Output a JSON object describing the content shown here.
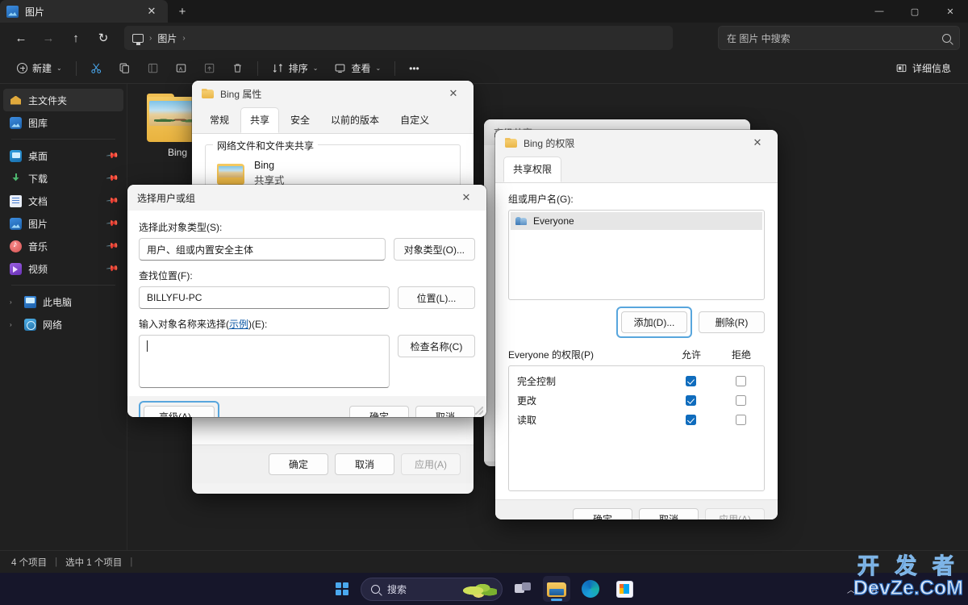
{
  "explorer": {
    "tab": {
      "title": "图片",
      "close_label": "✕",
      "new_tab_label": "+",
      "icon": "pictures-icon"
    },
    "window_controls": {
      "minimize": "—",
      "maximize": "▢",
      "close": "✕"
    },
    "nav": {
      "back": "←",
      "forward": "→",
      "up": "↑",
      "refresh": "↻",
      "breadcrumb": [
        "图片"
      ],
      "breadcrumb_sep": "›"
    },
    "search": {
      "placeholder": "在 图片 中搜索",
      "icon": "search-icon"
    },
    "toolbar": {
      "new_label": "新建",
      "cut_label": "剪切",
      "copy_label": "复制",
      "paste_label": "粘贴",
      "rename_label": "重命名",
      "share_label": "共享",
      "delete_label": "删除",
      "sort_label": "排序",
      "view_label": "查看",
      "more_label": "•••",
      "details_label": "详细信息",
      "chevron": "⌄"
    },
    "sidebar": {
      "items": [
        {
          "label": "主文件夹",
          "icon": "home-icon",
          "selected": true
        },
        {
          "label": "图库",
          "icon": "gallery-icon",
          "selected": false
        }
      ],
      "pinned": [
        {
          "label": "桌面",
          "icon": "desktop-icon",
          "pin": "📌"
        },
        {
          "label": "下载",
          "icon": "download-icon",
          "pin": "📌"
        },
        {
          "label": "文档",
          "icon": "documents-icon",
          "pin": "📌"
        },
        {
          "label": "图片",
          "icon": "pictures-icon",
          "pin": "📌"
        },
        {
          "label": "音乐",
          "icon": "music-icon",
          "pin": "📌"
        },
        {
          "label": "视频",
          "icon": "video-icon",
          "pin": "📌"
        }
      ],
      "trees": [
        {
          "label": "此电脑",
          "icon": "this-pc-icon",
          "arrow": "›"
        },
        {
          "label": "网络",
          "icon": "network-icon",
          "arrow": "›"
        }
      ]
    },
    "files": [
      {
        "name": "Bing",
        "icon": "folder-icon"
      }
    ],
    "status": {
      "count": "4 个项目",
      "sep1": "|",
      "selected": "选中 1 个项目",
      "sep2": "|"
    }
  },
  "dialog_properties": {
    "title": "Bing 属性",
    "close": "✕",
    "tabs": [
      {
        "label": "常规",
        "active": false
      },
      {
        "label": "共享",
        "active": true
      },
      {
        "label": "安全",
        "active": false
      },
      {
        "label": "以前的版本",
        "active": false
      },
      {
        "label": "自定义",
        "active": false
      }
    ],
    "group_label": "网络文件和文件夹共享",
    "share_name": "Bing",
    "share_state": "共享式",
    "buttons": [
      {
        "label": "确定",
        "disabled": false
      },
      {
        "label": "取消",
        "disabled": false
      },
      {
        "label": "应用(A)",
        "disabled": true
      }
    ]
  },
  "dialog_advanced_sharing": {
    "title": "高级共享",
    "close": "⌄"
  },
  "dialog_permissions": {
    "title": "Bing 的权限",
    "close": "✕",
    "tabs": [
      {
        "label": "共享权限",
        "active": true
      }
    ],
    "group_users_label": "组或用户名(G):",
    "users": [
      {
        "name": "Everyone",
        "icon": "users-icon",
        "selected": true
      }
    ],
    "add_button": "添加(D)...",
    "add_button_focused": true,
    "remove_button": "删除(R)",
    "perm_header": {
      "title": "Everyone 的权限(P)",
      "allow": "允许",
      "deny": "拒绝"
    },
    "permissions": [
      {
        "name": "完全控制",
        "allow": true,
        "deny": false
      },
      {
        "name": "更改",
        "allow": true,
        "deny": false
      },
      {
        "name": "读取",
        "allow": true,
        "deny": false
      }
    ],
    "buttons": [
      {
        "label": "确定",
        "disabled": false
      },
      {
        "label": "取消",
        "disabled": false
      },
      {
        "label": "应用(A)",
        "disabled": true
      }
    ]
  },
  "dialog_select_users": {
    "title": "选择用户或组",
    "close": "✕",
    "object_type_label": "选择此对象类型(S):",
    "object_type_value": "用户、组或内置安全主体",
    "object_type_button": "对象类型(O)...",
    "location_label": "查找位置(F):",
    "location_value": "BILLYFU-PC",
    "location_button": "位置(L)...",
    "names_label_pre": "输入对象名称来选择(",
    "names_label_link": "示例",
    "names_label_post": ")(E):",
    "names_value": "",
    "check_names_button": "检查名称(C)",
    "advanced_button": "高级(A)...",
    "advanced_button_focused": true,
    "ok_button": "确定",
    "cancel_button": "取消"
  },
  "taskbar": {
    "start_label": "开始",
    "search_placeholder": "搜索",
    "apps": [
      {
        "name": "task-view",
        "label": "任务视图",
        "active": false
      },
      {
        "name": "file-explorer",
        "label": "文件资源管理器",
        "active": true
      },
      {
        "name": "edge",
        "label": "Microsoft Edge",
        "active": false
      },
      {
        "name": "microsoft-store",
        "label": "Microsoft Store",
        "active": false
      }
    ],
    "tray": {
      "chevron": "︿",
      "ime": "中"
    }
  },
  "watermark": {
    "line1": "开 发 者",
    "line2": "DevZe.CoM"
  }
}
